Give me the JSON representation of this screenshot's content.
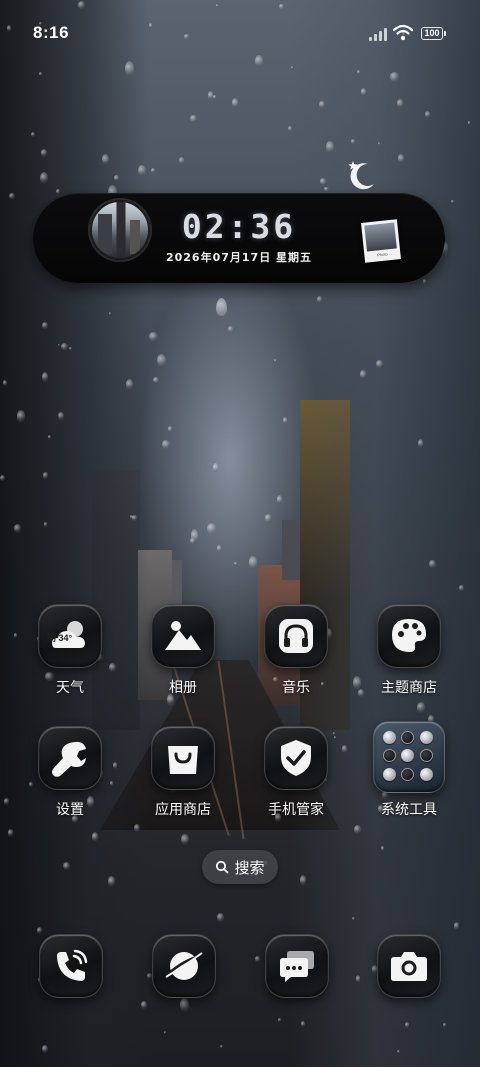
{
  "status_bar": {
    "time": "8:16",
    "battery": "100",
    "icons": [
      "signal-icon",
      "wifi-icon",
      "battery-icon"
    ]
  },
  "clock_widget": {
    "time": "02:36",
    "date": "2026年07月17日 星期五",
    "polaroid_caption": "Photo",
    "icons": [
      "moon-star-icon",
      "photo-thumbnail",
      "polaroid-photo"
    ]
  },
  "apps": [
    {
      "id": "weather",
      "label": "天气",
      "icon": "weather-cloud-icon",
      "badge": "阴 34°"
    },
    {
      "id": "gallery",
      "label": "相册",
      "icon": "gallery-mountain-icon"
    },
    {
      "id": "music",
      "label": "音乐",
      "icon": "headphones-icon"
    },
    {
      "id": "themes",
      "label": "主题商店",
      "icon": "palette-icon"
    },
    {
      "id": "settings",
      "label": "设置",
      "icon": "wrench-icon"
    },
    {
      "id": "app-store",
      "label": "应用商店",
      "icon": "shopping-bag-icon"
    },
    {
      "id": "security",
      "label": "手机管家",
      "icon": "shield-check-icon"
    },
    {
      "id": "system-tools",
      "label": "系统工具",
      "icon": "folder-grid-icon"
    }
  ],
  "search": {
    "label": "搜索",
    "icon": "search-icon"
  },
  "dock": [
    {
      "id": "phone",
      "icon": "phone-icon"
    },
    {
      "id": "browser",
      "icon": "browser-planet-icon"
    },
    {
      "id": "messages",
      "icon": "message-bubbles-icon"
    },
    {
      "id": "camera",
      "icon": "camera-icon"
    }
  ],
  "colors": {
    "icon_glass": "#1a1b1f",
    "widget_bg": "#08080a",
    "text": "#ffffff"
  }
}
